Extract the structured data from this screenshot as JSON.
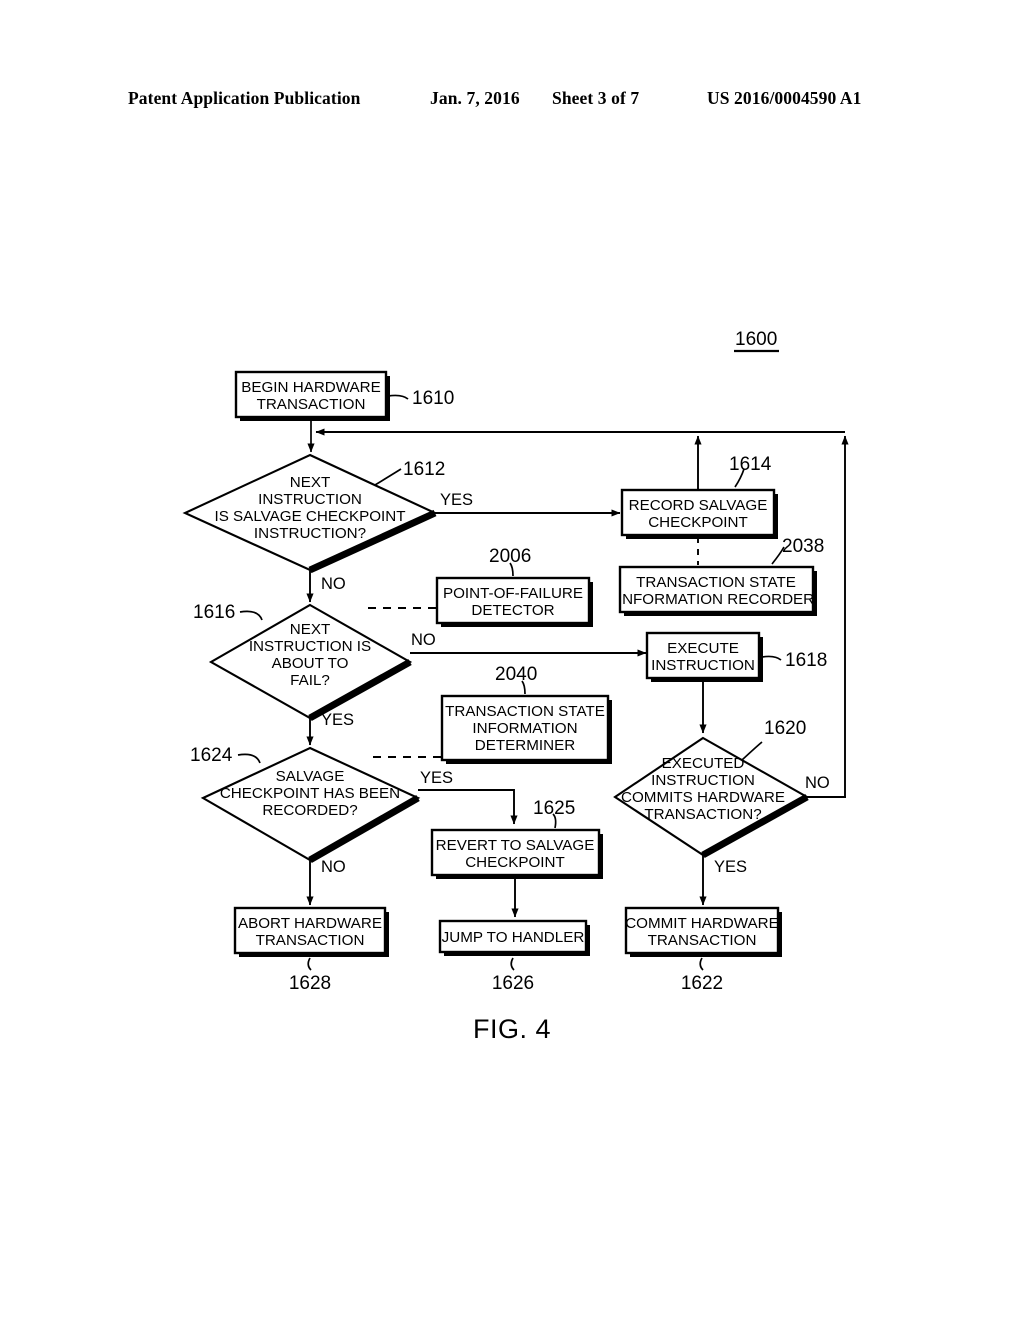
{
  "header": {
    "publication": "Patent Application Publication",
    "date": "Jan. 7, 2016",
    "sheet": "Sheet 3 of 7",
    "patent_number": "US 2016/0004590 A1"
  },
  "figure": {
    "caption": "FIG. 4",
    "diagram_ref": "1600"
  },
  "nodes": {
    "begin": {
      "label_line1": "BEGIN HARDWARE",
      "label_line2": "TRANSACTION",
      "ref": "1610"
    },
    "is_salvage_cp": {
      "line1": "NEXT",
      "line2": "INSTRUCTION",
      "line3": "IS SALVAGE CHECKPOINT",
      "line4": "INSTRUCTION?",
      "ref": "1612"
    },
    "record_salvage": {
      "line1": "RECORD SALVAGE",
      "line2": "CHECKPOINT",
      "ref": "1614"
    },
    "state_recorder": {
      "line1": "TRANSACTION STATE",
      "line2": "INFORMATION RECORDER",
      "ref": "2038"
    },
    "pof_detector": {
      "line1": "POINT-OF-FAILURE",
      "line2": "DETECTOR",
      "ref": "2006"
    },
    "about_to_fail": {
      "line1": "NEXT",
      "line2": "INSTRUCTION IS",
      "line3": "ABOUT TO",
      "line4": "FAIL?",
      "ref": "1616"
    },
    "execute_instruction": {
      "line1": "EXECUTE",
      "line2": "INSTRUCTION",
      "ref": "1618"
    },
    "state_determiner": {
      "line1": "TRANSACTION STATE",
      "line2": "INFORMATION",
      "line3": "DETERMINER",
      "ref": "2040"
    },
    "cp_recorded": {
      "line1": "SALVAGE",
      "line2": "CHECKPOINT HAS BEEN",
      "line3": "RECORDED?",
      "ref": "1624"
    },
    "commits_txn": {
      "line1": "EXECUTED",
      "line2": "INSTRUCTION",
      "line3": "COMMITS HARDWARE",
      "line4": "TRANSACTION?",
      "ref": "1620"
    },
    "revert_cp": {
      "line1": "REVERT TO SALVAGE",
      "line2": "CHECKPOINT",
      "ref": "1625"
    },
    "abort_txn": {
      "line1": "ABORT HARDWARE",
      "line2": "TRANSACTION",
      "ref": "1628"
    },
    "jump_handler": {
      "line1": "JUMP TO HANDLER",
      "ref": "1626"
    },
    "commit_txn": {
      "line1": "COMMIT HARDWARE",
      "line2": "TRANSACTION",
      "ref": "1622"
    }
  },
  "edge_labels": {
    "yes_1612": "YES",
    "no_1612": "NO",
    "no_1616": "NO",
    "yes_1616": "YES",
    "yes_1624": "YES",
    "no_1624": "NO",
    "no_1620": "NO",
    "yes_1620": "YES"
  },
  "colors": {
    "ink": "#000000",
    "paper": "#ffffff"
  }
}
